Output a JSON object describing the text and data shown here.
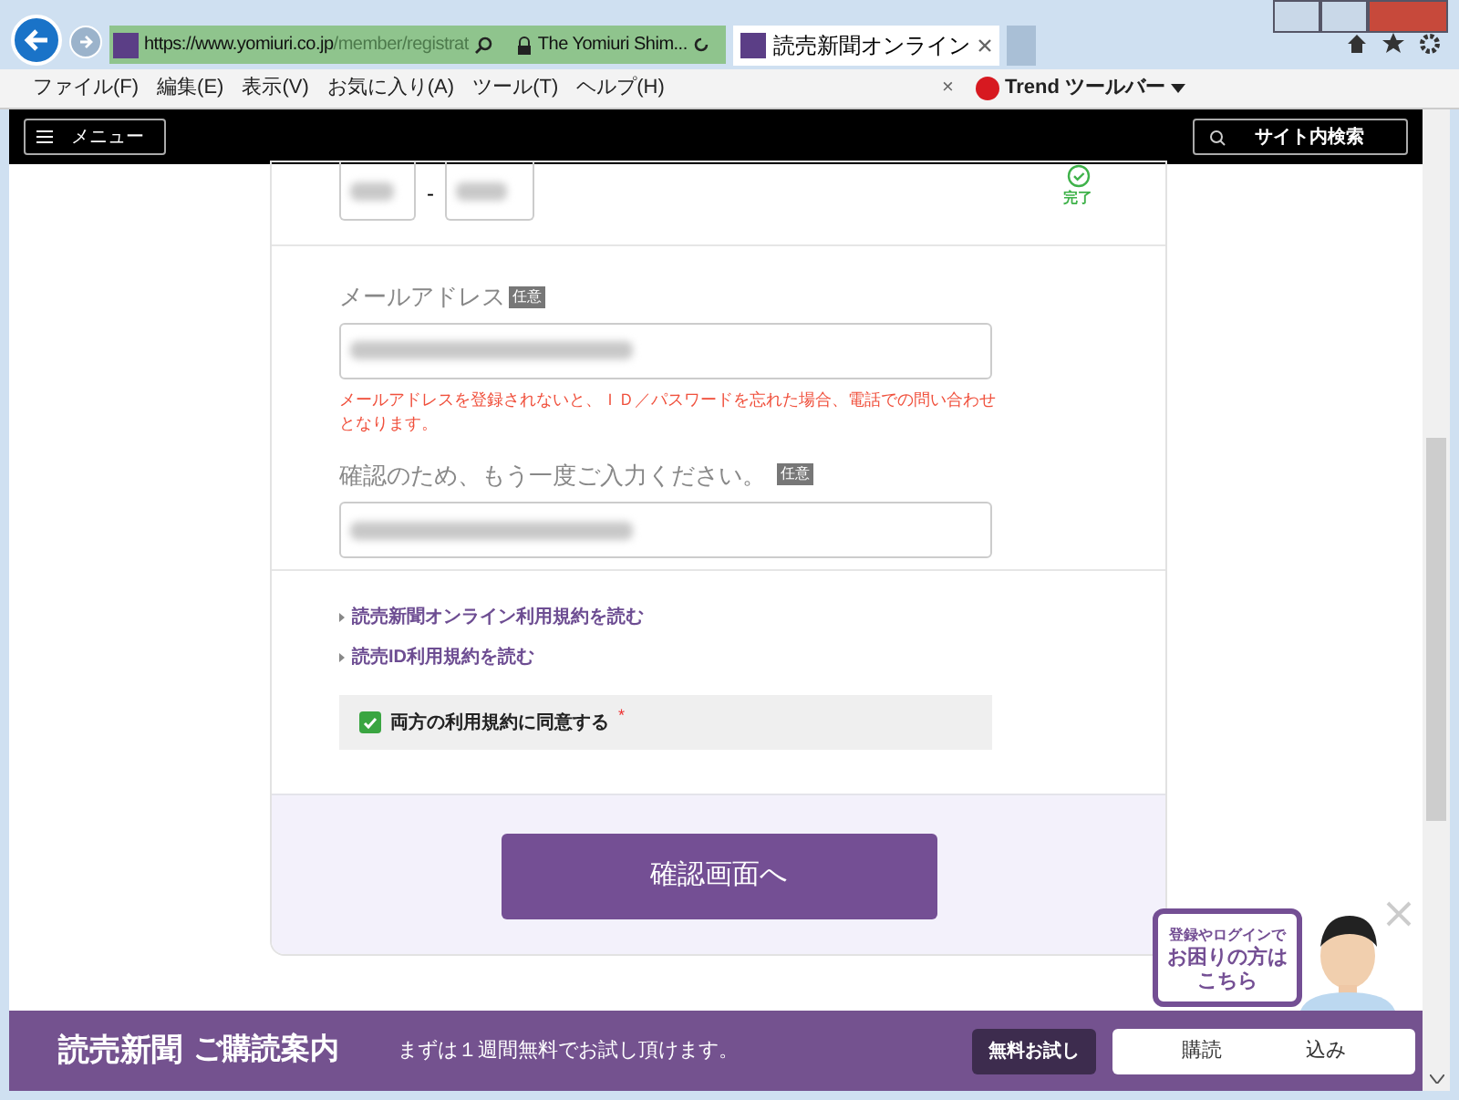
{
  "browser": {
    "url_host": "https://www.yomiuri.co.jp",
    "url_path": "/member/registrat",
    "site_identity": "The Yomiuri Shim...",
    "tabs": [
      {
        "title": "読売新聞オンライン",
        "selected": true
      }
    ],
    "menu": [
      "ファイル(F)",
      "編集(E)",
      "表示(V)",
      "お気に入り(A)",
      "ツール(T)",
      "ヘルプ(H)"
    ],
    "toolbar_close": "×",
    "toolbar": "Trend ツールバー"
  },
  "site_header": {
    "menu_button": "メニュー",
    "search_button": "サイト内検索"
  },
  "postal": {
    "separator": "-",
    "status": "完了"
  },
  "email": {
    "label": "メールアドレス",
    "badge": "任意",
    "note": "メールアドレスを登録されないと、ＩＤ／パスワードを忘れた場合、電話での問い合わせとなります。",
    "confirm_label": "確認のため、もう一度ご入力ください。",
    "confirm_badge": "任意"
  },
  "links": [
    "読売新聞オンライン利用規約を読む",
    "読売ID利用規約を読む"
  ],
  "agreement": {
    "label": "両方の利用規約に同意する",
    "checked": true,
    "required_mark": "*"
  },
  "submit": "確認画面へ",
  "banner": {
    "logo": "読売新聞",
    "subtitle": "ご購読案内",
    "text": "まずは１週間無料でお試し頂けます。",
    "trial_button": "無料お試し",
    "subscribe_button": [
      "購読",
      "込み"
    ]
  },
  "help_bubble": [
    "登録やログインで",
    "お困りの方は",
    "こちら"
  ]
}
